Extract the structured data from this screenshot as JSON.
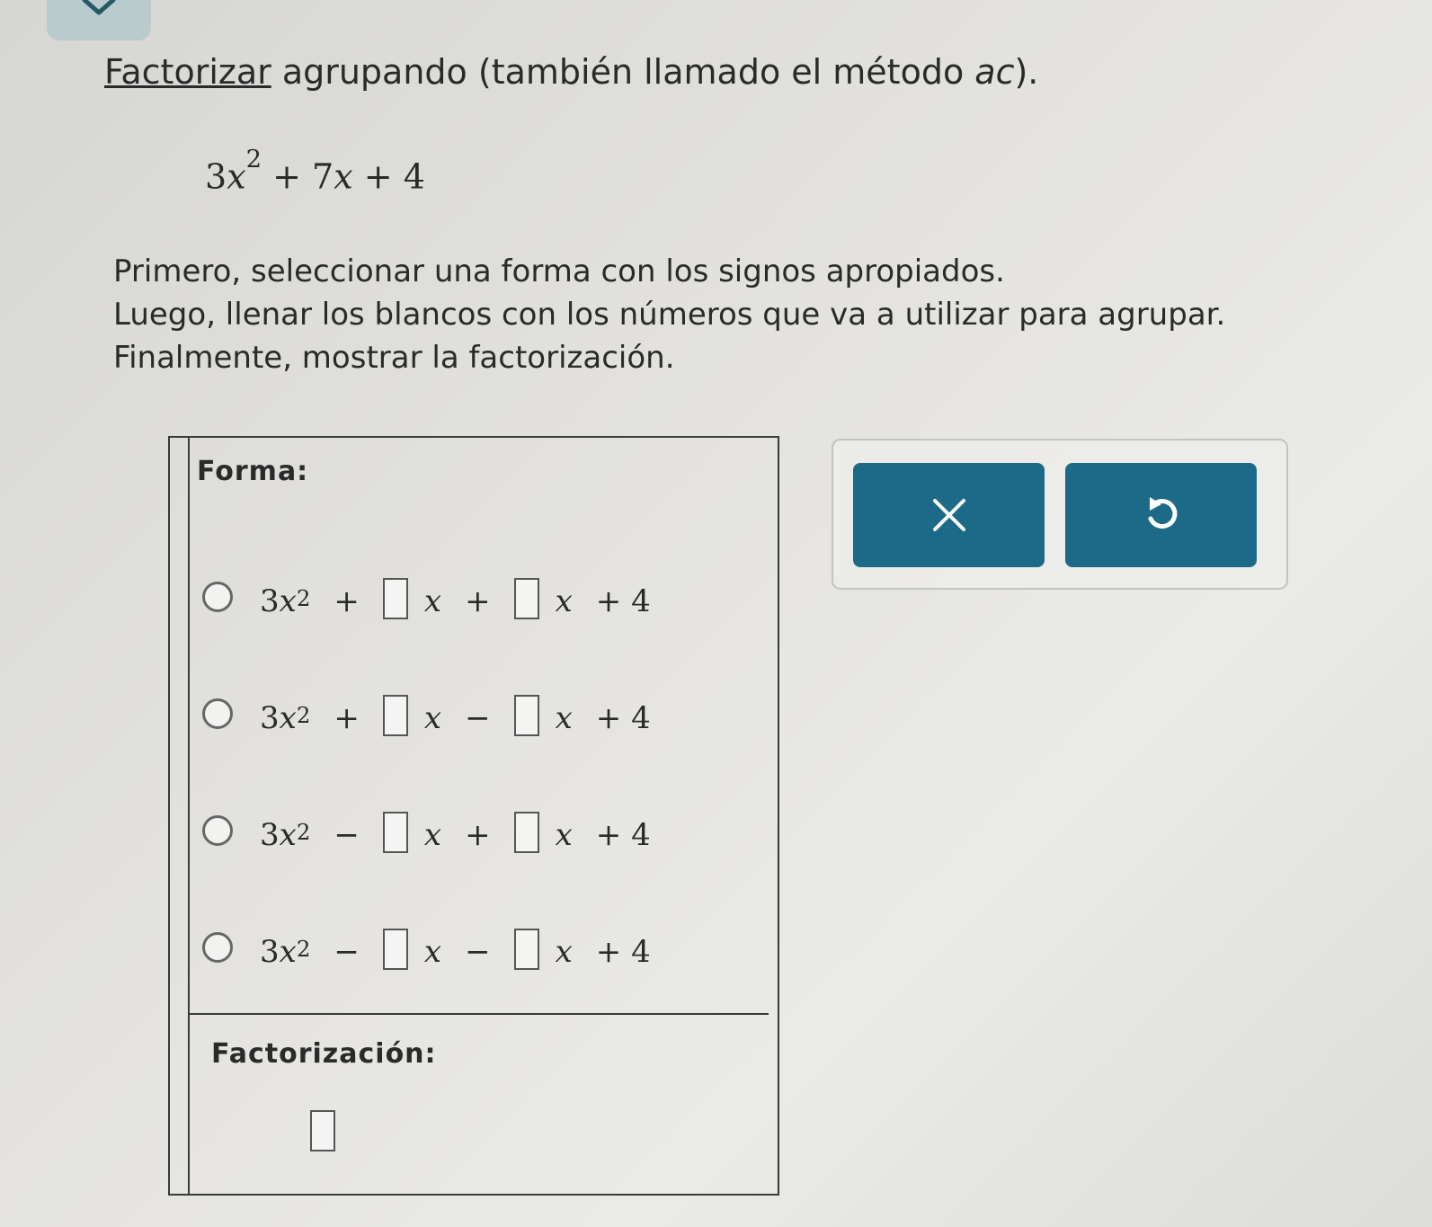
{
  "title": {
    "link_text": "Factorizar",
    "text_mid": " agrupando (también llamado el método ",
    "ac": "ac",
    "text_end": ")."
  },
  "polynomial": {
    "a": "3",
    "x": "x",
    "exp": "2",
    "b_term": "+ 7",
    "x2": "x",
    "c_term": "+ 4"
  },
  "instructions": [
    "Primero, seleccionar una forma con los signos apropiados.",
    "Luego, llenar los blancos con los números que va a utilizar para agrupar.",
    "Finalmente, mostrar la factorización."
  ],
  "forma_label": "Forma:",
  "forma_options": [
    {
      "lead": "3",
      "x": "x",
      "exp": "2",
      "sign1": "+",
      "sign2": "+",
      "tail": "+ 4"
    },
    {
      "lead": "3",
      "x": "x",
      "exp": "2",
      "sign1": "+",
      "sign2": "−",
      "tail": "+ 4"
    },
    {
      "lead": "3",
      "x": "x",
      "exp": "2",
      "sign1": "−",
      "sign2": "+",
      "tail": "+ 4"
    },
    {
      "lead": "3",
      "x": "x",
      "exp": "2",
      "sign1": "−",
      "sign2": "−",
      "tail": "+ 4"
    }
  ],
  "factorizacion_label": "Factorización:",
  "tools": {
    "clear_icon": "x-icon",
    "undo_icon": "undo-icon"
  },
  "colors": {
    "button": "#1c6a87",
    "tab": "#b9cbcd"
  }
}
